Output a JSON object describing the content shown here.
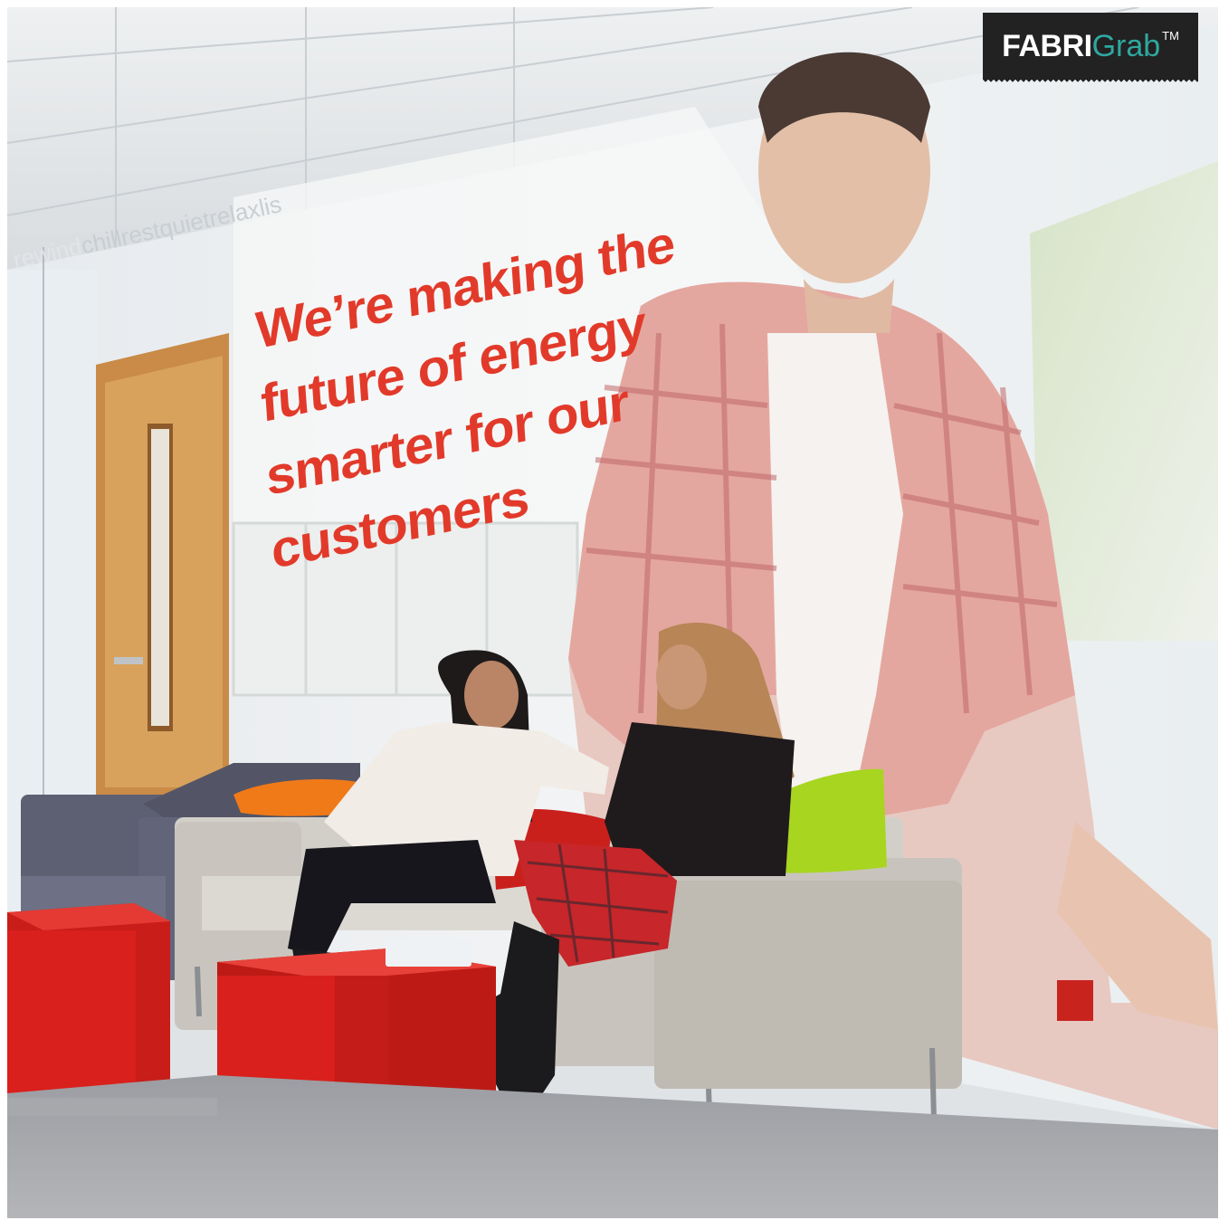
{
  "photo": {
    "slogan_lines": [
      "We’re making the",
      "future of energy",
      "smarter for our",
      "customers"
    ],
    "wall_words": "chillrestquietrelaxlis",
    "wall_words_faint": "rewind",
    "colors": {
      "slogan": "#e23a2a",
      "tables": "#d9201c",
      "sofa": "#c8c4bd",
      "cushion_orange": "#f07a18",
      "cushion_green": "#a8d520",
      "carpet": "#a9aaae"
    }
  },
  "logo": {
    "brand_bold": "FABRI",
    "brand_light": "Grab",
    "trademark": "TM",
    "colors": {
      "background": "#222222",
      "accent": "#2fa8a0"
    }
  }
}
